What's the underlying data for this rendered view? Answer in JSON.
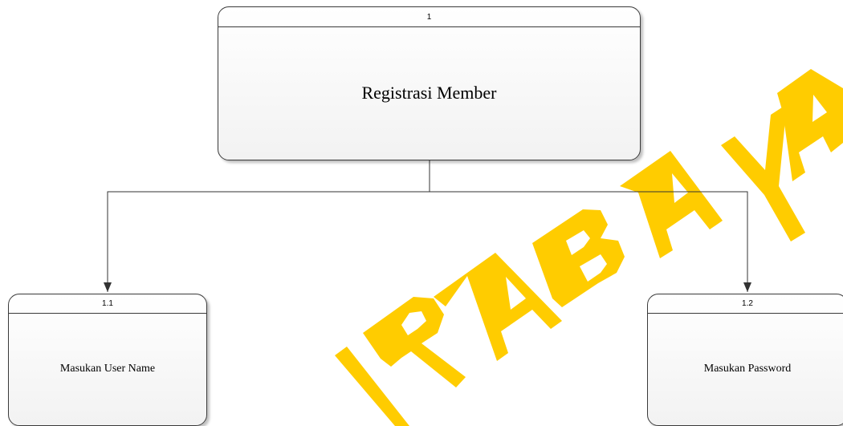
{
  "colors": {
    "watermark": "#ffcc00",
    "border": "#3a3a3a",
    "connector": "#333333"
  },
  "processes": {
    "root": {
      "number": "1",
      "name": "Registrasi Member"
    },
    "child_1": {
      "number": "1.1",
      "name": "Masukan User Name"
    },
    "child_2": {
      "number": "1.2",
      "name": "Masukan Password"
    }
  },
  "watermark": {
    "text": "SURABAYA",
    "visible_text": "IRABAYA"
  }
}
